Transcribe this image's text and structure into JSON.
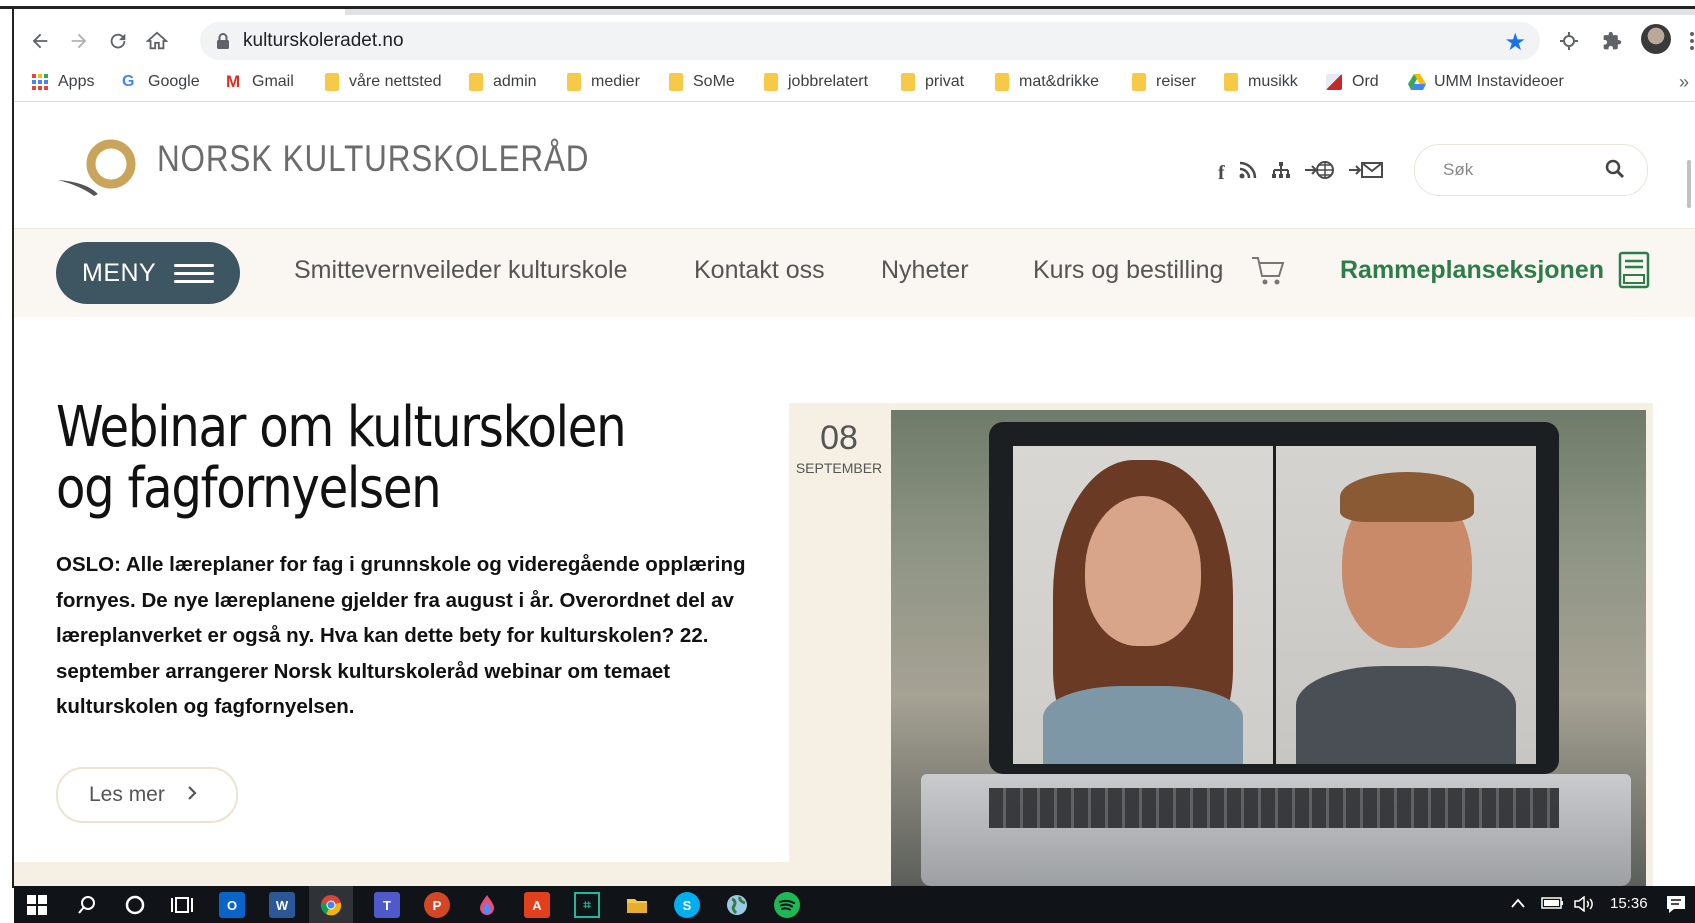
{
  "browser": {
    "url": "kulturskoleradet.no",
    "bookmarks": [
      {
        "label": "Apps",
        "icon": "apps-grid-icon"
      },
      {
        "label": "Google",
        "icon": "google-icon"
      },
      {
        "label": "Gmail",
        "icon": "gmail-icon"
      },
      {
        "label": "våre nettsted",
        "icon": "folder-icon"
      },
      {
        "label": "admin",
        "icon": "folder-icon"
      },
      {
        "label": "medier",
        "icon": "folder-icon"
      },
      {
        "label": "SoMe",
        "icon": "folder-icon"
      },
      {
        "label": "jobbrelatert",
        "icon": "folder-icon"
      },
      {
        "label": "privat",
        "icon": "folder-icon"
      },
      {
        "label": "mat&drikke",
        "icon": "folder-icon"
      },
      {
        "label": "reiser",
        "icon": "folder-icon"
      },
      {
        "label": "musikk",
        "icon": "folder-icon"
      },
      {
        "label": "Ord",
        "icon": "ord-icon"
      },
      {
        "label": "UMM Instavideoer",
        "icon": "drive-icon"
      }
    ],
    "more_label": "»"
  },
  "site": {
    "brand": "NORSK KULTURSKOLERÅD",
    "search_placeholder": "Søk",
    "header_icons": [
      "facebook-icon",
      "rss-icon",
      "sitemap-icon",
      "language-icon",
      "newsletter-icon"
    ],
    "nav": {
      "menu_label": "MENY",
      "links": [
        "Smittevernveileder kulturskole",
        "Kontakt oss",
        "Nyheter",
        "Kurs og bestilling"
      ],
      "highlight": "Rammeplanseksjonen"
    },
    "article": {
      "title": "Webinar om kulturskolen og fagfornyelsen",
      "lead": "OSLO: Alle læreplaner for fag i grunnskole og videregående opplæring fornyes. De nye læreplanene gjelder fra august i år. Overordnet del av læreplanverket er også ny. Hva kan dette bety for kulturskolen? 22. september arrangerer Norsk kulturskoleråd webinar om temaet kulturskolen og fagfornyelsen.",
      "button": "Les mer",
      "date_day": "08",
      "date_month": "SEPTEMBER"
    }
  },
  "taskbar": {
    "clock": "15:36",
    "apps": [
      "windows-start-icon",
      "search-icon",
      "cortana-icon",
      "task-view-icon",
      "outlook-icon",
      "word-icon",
      "chrome-icon",
      "teams-icon",
      "powerpoint-icon",
      "paint-icon",
      "acrobat-icon",
      "app-icon",
      "file-explorer-icon",
      "skype-icon",
      "globe-icon",
      "spotify-icon"
    ]
  },
  "colors": {
    "menu_button": "#3e5661",
    "highlight_green": "#2d7d4a",
    "beige": "#f6efe3",
    "star_blue": "#1a73e8"
  }
}
